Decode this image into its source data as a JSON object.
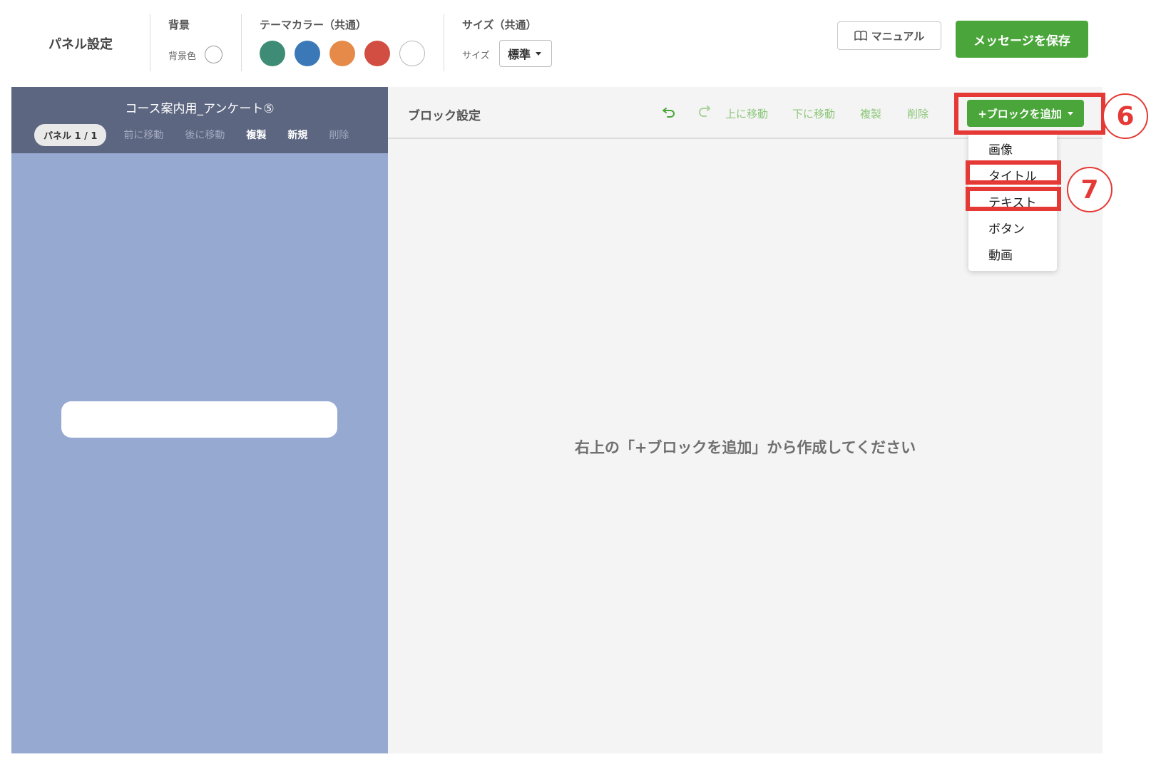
{
  "topbar": {
    "panel_settings": "パネル設定",
    "background": {
      "label": "背景",
      "color_label": "背景色"
    },
    "theme_color": {
      "label": "テーマカラー（共通）",
      "swatches": [
        "#3e8c76",
        "#3a78b7",
        "#e58a48",
        "#d24e42",
        "#ffffff"
      ]
    },
    "size": {
      "label": "サイズ（共通）",
      "field_label": "サイズ",
      "selected": "標準"
    },
    "manual_label": "マニュアル",
    "save_label": "メッセージを保存"
  },
  "left_panel": {
    "title": "コース案内用_アンケート⑤",
    "pill": "パネル 1 / 1",
    "tabs": [
      "前に移動",
      "後に移動",
      "複製",
      "新規",
      "削除"
    ]
  },
  "right_panel": {
    "title": "ブロック設定",
    "tools": [
      "上に移動",
      "下に移動",
      "複製",
      "削除"
    ],
    "add_block_label": "+ブロックを追加",
    "menu": [
      "画像",
      "タイトル",
      "テキスト",
      "ボタン",
      "動画"
    ],
    "empty_message": "右上の「+ブロックを追加」から作成してください"
  },
  "annotations": {
    "badge_6": "6",
    "badge_7": "7"
  },
  "colors": {
    "accent_green": "#4aa63a",
    "highlight_red": "#e53935",
    "left_header": "#5c6680",
    "left_preview_bg": "#96a9d1"
  }
}
